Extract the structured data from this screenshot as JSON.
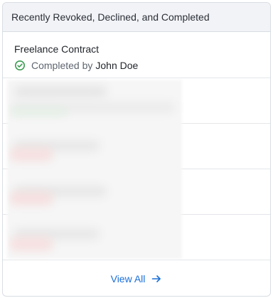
{
  "header": {
    "title": "Recently Revoked, Declined, and Completed"
  },
  "items": [
    {
      "name": "Freelance Contract",
      "status_prefix": "Completed by",
      "user": "John Doe",
      "status_icon": "check-circle-icon",
      "status_color": "#3a9b4f"
    }
  ],
  "footer": {
    "view_all_label": "View All",
    "icon": "arrow-right-icon"
  },
  "colors": {
    "link": "#1a6fd8",
    "header_bg": "#f1f3f7",
    "border": "#d9dde3"
  }
}
